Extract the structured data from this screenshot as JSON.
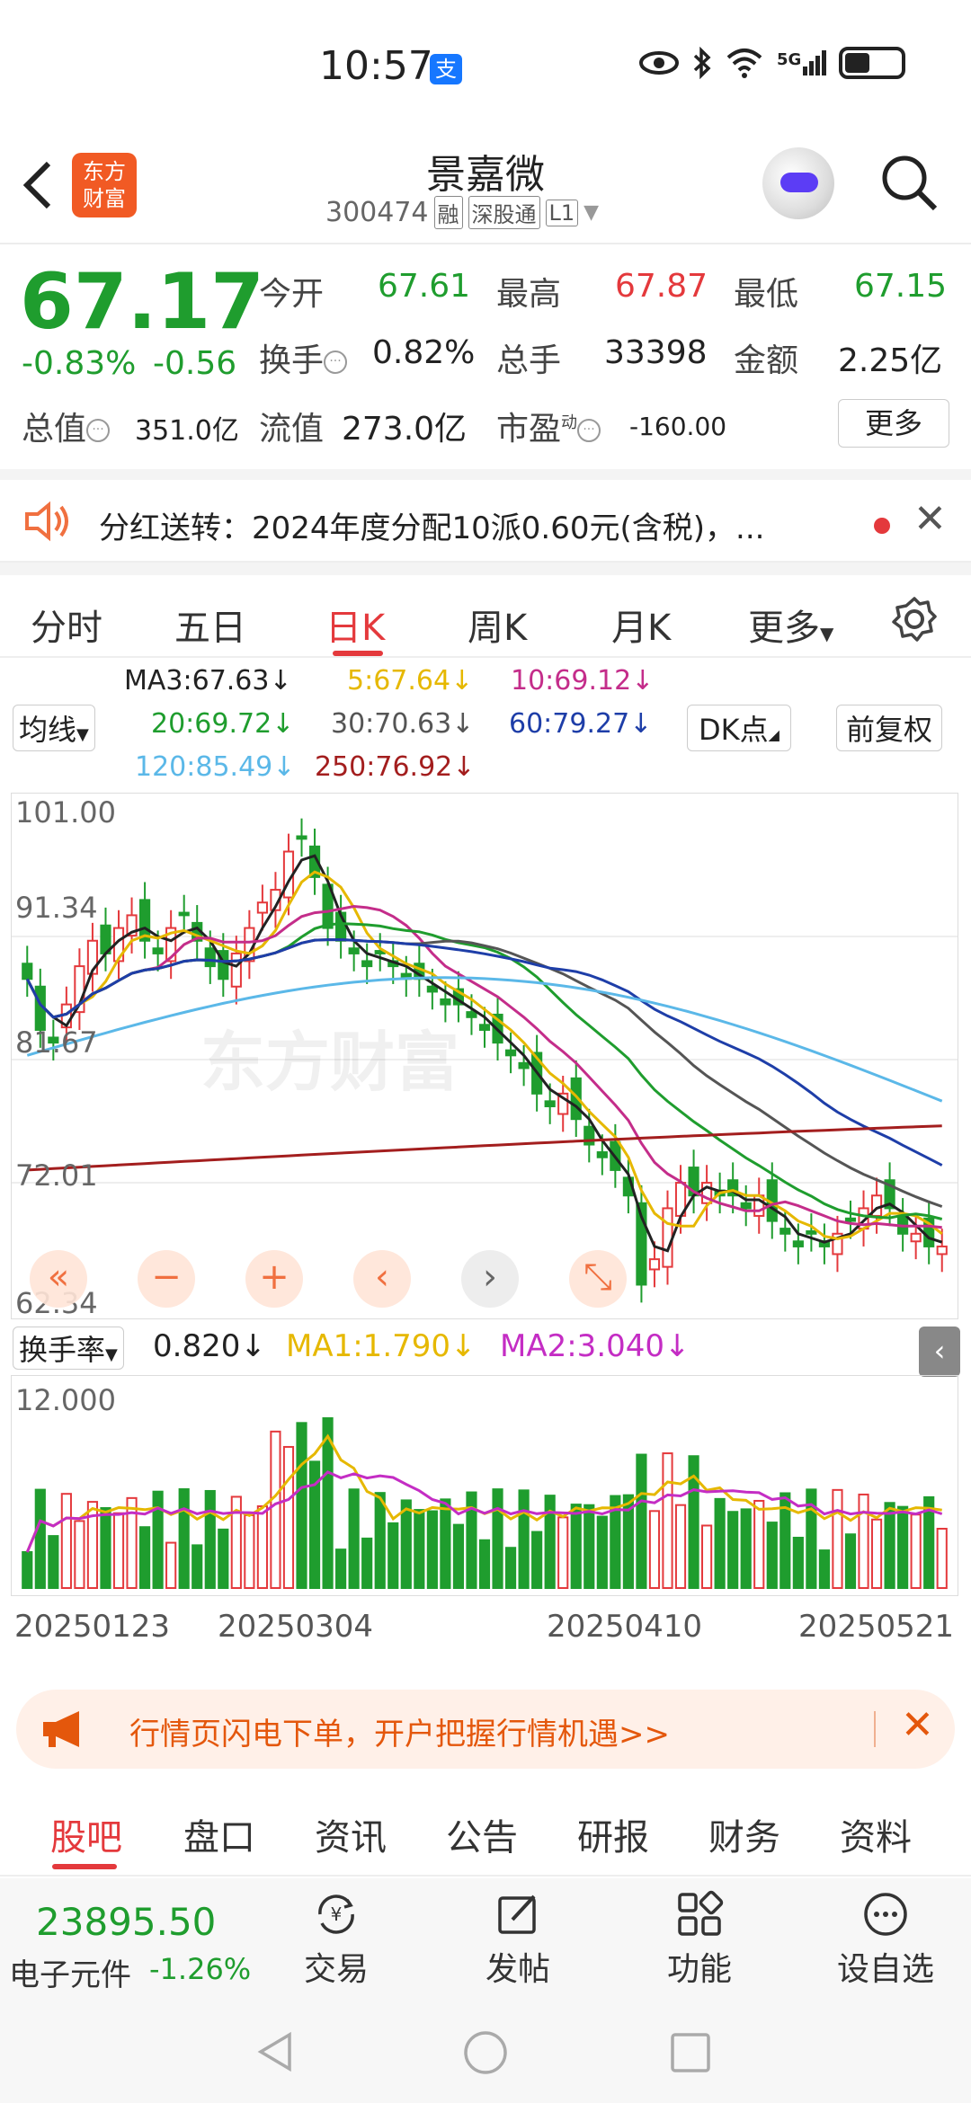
{
  "status_bar": {
    "time": "10:57",
    "pay_badge": "支",
    "signal": "5G",
    "battery_level": 0.45
  },
  "header": {
    "stock_name": "景嘉微",
    "stock_code": "300474",
    "tags": [
      "融",
      "深股通",
      "L1"
    ],
    "logo_line1": "东方",
    "logo_line2": "财富"
  },
  "quote": {
    "price": "67.17",
    "change_pct": "-0.83%",
    "change_amt": "-0.56",
    "open_label": "今开",
    "open_val": "67.61",
    "high_label": "最高",
    "high_val": "67.87",
    "low_label": "最低",
    "low_val": "67.15",
    "turnover_label": "换手",
    "turnover_val": "0.82%",
    "volume_label": "总手",
    "volume_val": "33398",
    "amount_label": "金额",
    "amount_val": "2.25亿",
    "total_cap_label": "总值",
    "total_cap_val": "351.0亿",
    "float_cap_label": "流值",
    "float_cap_val": "273.0亿",
    "pe_label": "市盈",
    "pe_sup": "动",
    "pe_val": "-160.00",
    "more_label": "更多"
  },
  "dividend": {
    "text": "分红送转：2024年度分配10派0.60元(含税)，..."
  },
  "period_tabs": [
    "分时",
    "五日",
    "日K",
    "周K",
    "月K",
    "更多"
  ],
  "ma": {
    "selector": "均线",
    "ma3": "MA3:67.63↓",
    "ma5": "5:67.64↓",
    "ma10": "10:69.12↓",
    "ma20": "20:69.72↓",
    "ma30": "30:70.63↓",
    "ma60": "60:79.27↓",
    "ma120": "120:85.49↓",
    "ma250": "250:76.92↓",
    "dk_label": "DK点",
    "adjust_label": "前复权"
  },
  "chart_data": {
    "type": "candlestick",
    "y_ticks": [
      "101.00",
      "91.34",
      "81.67",
      "72.01",
      "62.34"
    ],
    "ylim": [
      62.34,
      101.0
    ],
    "x_ticks": [
      "20250123",
      "20250304",
      "20250410",
      "20250521"
    ],
    "watermark": "东方财富",
    "close": [
      88,
      84,
      83,
      86,
      89,
      91,
      90,
      92,
      93,
      91,
      90,
      92,
      93,
      91,
      89,
      88,
      90,
      92,
      94,
      95,
      98,
      99,
      96,
      92,
      91,
      90,
      89,
      90,
      89,
      88,
      88,
      87,
      86,
      86,
      85,
      84,
      83,
      82,
      81,
      79,
      78,
      79,
      77,
      75,
      74,
      73,
      71,
      64,
      66,
      70,
      72,
      71,
      72,
      71,
      71,
      70,
      71,
      69,
      68,
      67,
      68,
      67,
      68,
      69,
      70,
      71,
      70,
      68,
      68,
      67,
      67
    ],
    "ma_lines": [
      "MA3",
      "MA5",
      "MA10",
      "MA20",
      "MA30",
      "MA60",
      "MA120",
      "MA250"
    ],
    "volume": {
      "selector": "换手率",
      "value": "0.820↓",
      "ma1": "MA1:1.790↓",
      "ma2": "MA2:3.040↓",
      "y_top": "12.000"
    }
  },
  "promo": {
    "text": "行情页闪电下单，开户把握行情机遇>>"
  },
  "content_tabs": [
    "股吧",
    "盘口",
    "资讯",
    "公告",
    "研报",
    "财务",
    "资料"
  ],
  "toolbar": {
    "index_value": "23895.50",
    "index_name": "电子元件",
    "index_change": "-1.26%",
    "tools": [
      "交易",
      "发帖",
      "功能",
      "设自选"
    ]
  },
  "colors": {
    "up": "#e4393c",
    "down": "#1f9d2e",
    "accent": "#e4393c",
    "promo": "#e4570c"
  }
}
